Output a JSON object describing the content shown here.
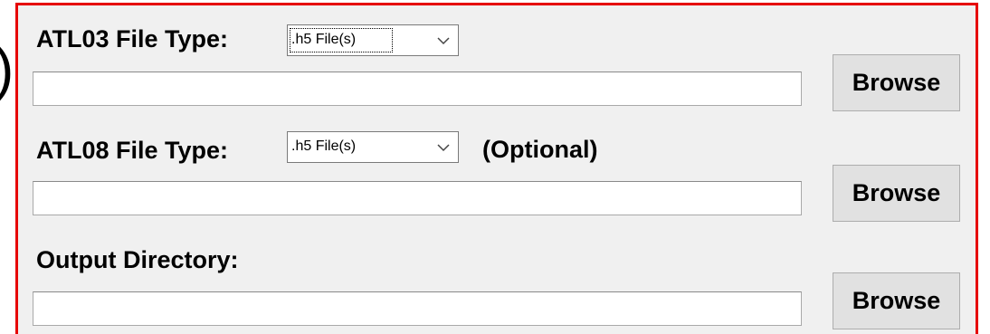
{
  "edge_glyph": ")",
  "atl03": {
    "label": "ATL03 File Type:",
    "file_type_selected": ".h5 File(s)",
    "path_value": "",
    "browse_label": "Browse"
  },
  "atl08": {
    "label": "ATL08 File Type:",
    "file_type_selected": ".h5 File(s)",
    "optional_note": "(Optional)",
    "path_value": "",
    "browse_label": "Browse"
  },
  "output": {
    "label": "Output Directory:",
    "path_value": "",
    "browse_label": "Browse"
  },
  "colors": {
    "highlight_border": "#e60000",
    "panel_background": "#f0f0f0",
    "button_background": "#e1e1e1"
  },
  "icons": {
    "dropdown": "chevron-down-icon"
  }
}
